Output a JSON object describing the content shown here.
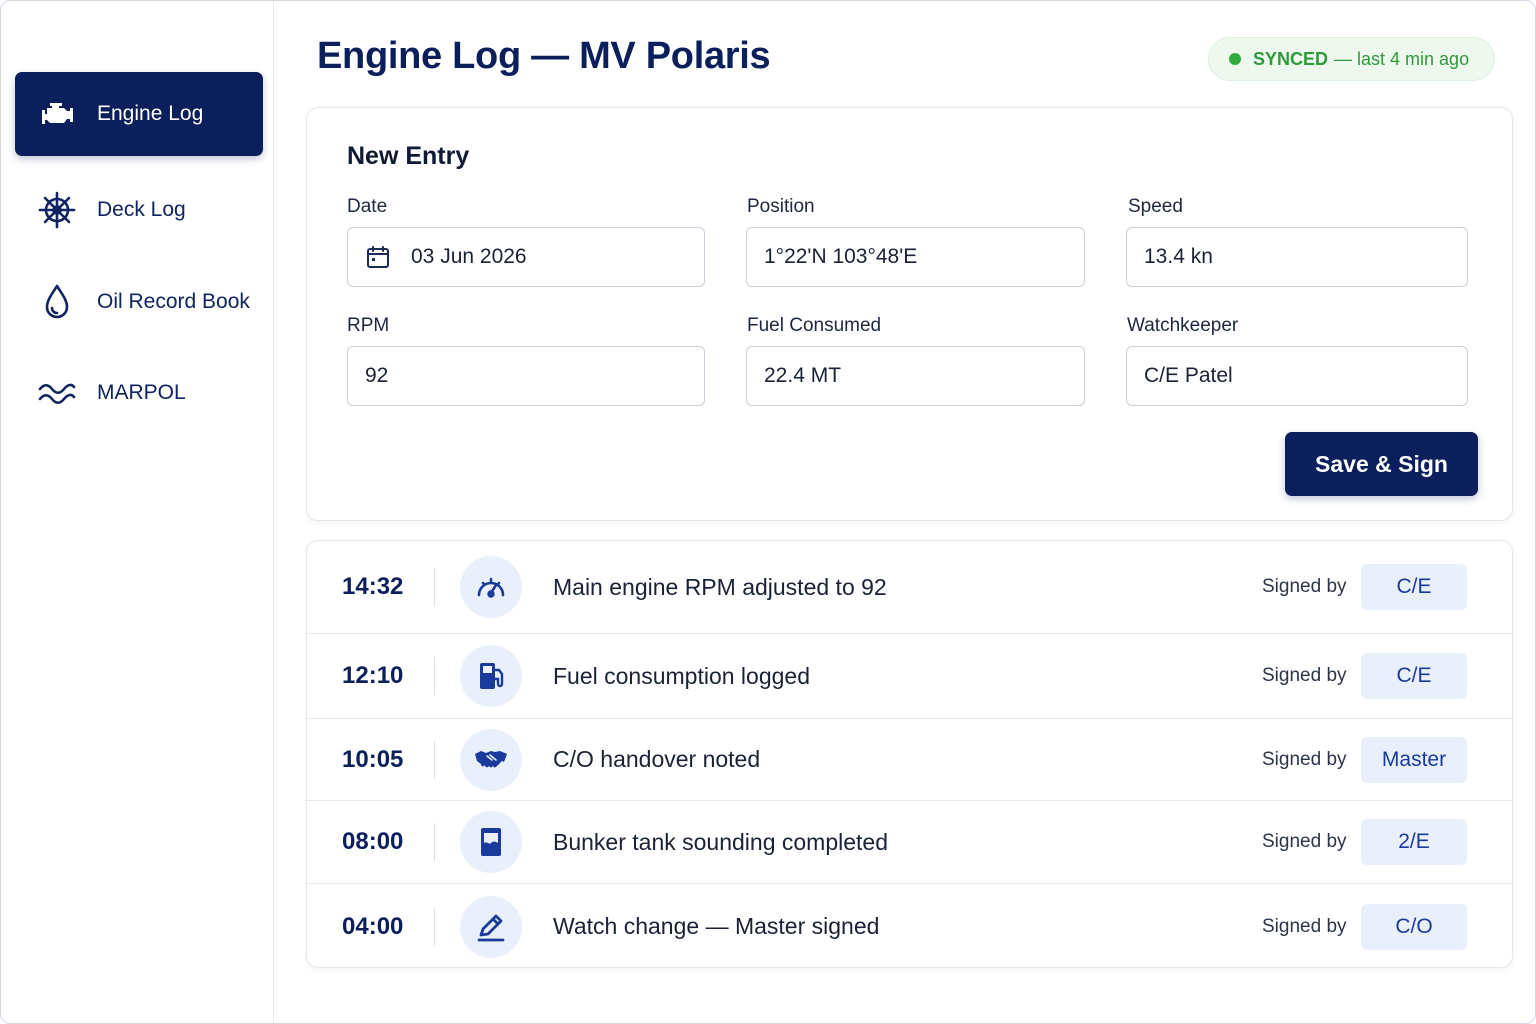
{
  "sidebar": {
    "items": [
      {
        "label": "Engine Log",
        "icon": "engine-icon",
        "active": true
      },
      {
        "label": "Deck Log",
        "icon": "ship-wheel-icon",
        "active": false
      },
      {
        "label": "Oil Record Book",
        "icon": "oil-drop-icon",
        "active": false
      },
      {
        "label": "MARPOL",
        "icon": "waves-icon",
        "active": false
      }
    ]
  },
  "header": {
    "title": "Engine Log — MV Polaris",
    "sync_status": "SYNCED",
    "sync_detail": "— last 4 min ago"
  },
  "entry": {
    "title": "New Entry",
    "fields": {
      "date": {
        "label": "Date",
        "value": "03 Jun 2026"
      },
      "position": {
        "label": "Position",
        "value": "1°22'N 103°48'E"
      },
      "speed": {
        "label": "Speed",
        "value": "13.4 kn"
      },
      "rpm": {
        "label": "RPM",
        "value": "92"
      },
      "fuel": {
        "label": "Fuel Consumed",
        "value": "22.4 MT"
      },
      "watchkeeper": {
        "label": "Watchkeeper",
        "value": "C/E Patel"
      }
    },
    "save_label": "Save & Sign"
  },
  "log": {
    "signed_by_label": "Signed by",
    "entries": [
      {
        "time": "14:32",
        "icon": "gauge-icon",
        "text": "Main engine RPM adjusted to 92",
        "signer": "C/E"
      },
      {
        "time": "12:10",
        "icon": "fuel-pump-icon",
        "text": "Fuel consumption logged",
        "signer": "C/E"
      },
      {
        "time": "10:05",
        "icon": "handshake-icon",
        "text": "C/O handover noted",
        "signer": "Master"
      },
      {
        "time": "08:00",
        "icon": "tank-icon",
        "text": "Bunker tank sounding completed",
        "signer": "2/E"
      },
      {
        "time": "04:00",
        "icon": "pen-icon",
        "text": "Watch change — Master signed",
        "signer": "C/O"
      }
    ]
  },
  "colors": {
    "primary": "#0b1f5c",
    "sync_green": "#2eab3b",
    "icon_bg": "#eaf0fb",
    "signer_bg": "#e9f0fc"
  }
}
